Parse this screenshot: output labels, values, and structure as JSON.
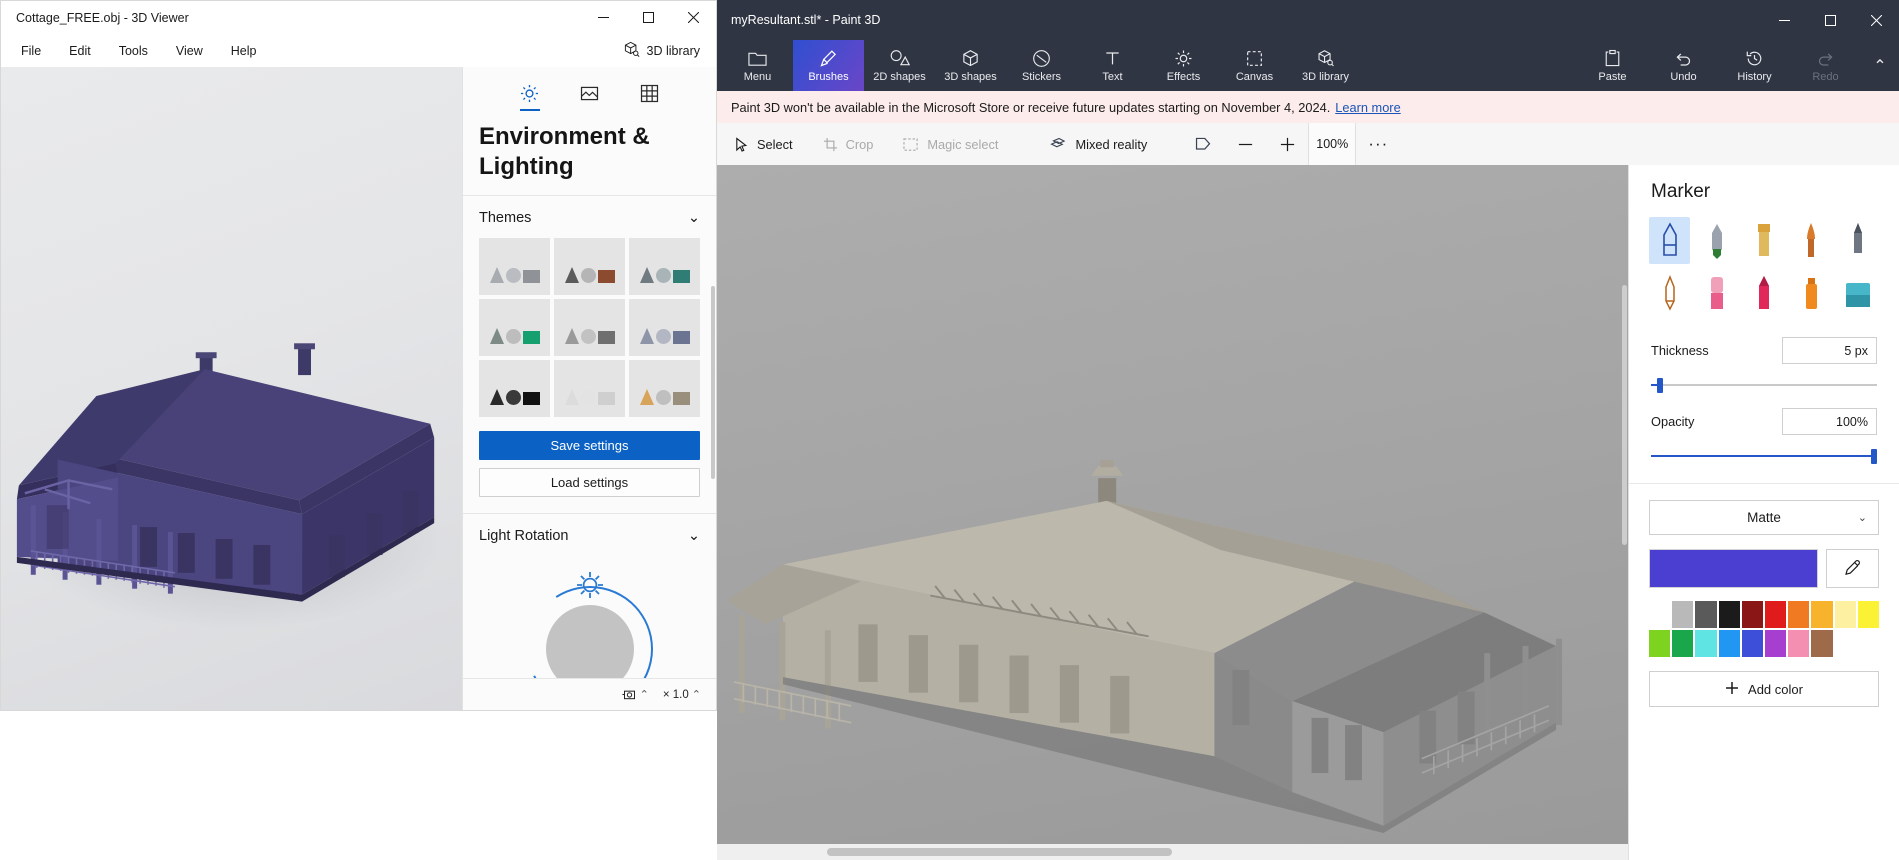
{
  "viewer": {
    "title": "Cottage_FREE.obj - 3D Viewer",
    "window_controls": {
      "minimize": "—",
      "maximize": "☐",
      "close": "✕"
    },
    "menu": [
      "File",
      "Edit",
      "Tools",
      "View",
      "Help"
    ],
    "library_label": "3D library",
    "panel": {
      "tabs": [
        "lighting-icon",
        "image-icon",
        "grid-icon"
      ],
      "heading": "Environment & Lighting",
      "themes": {
        "label": "Themes",
        "chevron": "⌄",
        "swatches": [
          {
            "sphere": "#b9bcc0",
            "box": "#8f9397",
            "cone": "#a8abaf"
          },
          {
            "sphere": "#b5b5b5",
            "box": "#8c4a2f",
            "cone": "#5b5b5b"
          },
          {
            "sphere": "#a9b4b8",
            "box": "#2f7d74",
            "cone": "#6f7b80"
          },
          {
            "sphere": "#bdbdbd",
            "box": "#16a06f",
            "cone": "#7d8a86"
          },
          {
            "sphere": "#c2c2c2",
            "box": "#6f6f6f",
            "cone": "#9a9a9a"
          },
          {
            "sphere": "#b3b7c4",
            "box": "#6b7490",
            "cone": "#8e95a8"
          },
          {
            "sphere": "#3a3a3a",
            "box": "#111111",
            "cone": "#2a2a2a"
          },
          {
            "sphere": "#e3e3e3",
            "box": "#cfcfcf",
            "cone": "#dcdcdc"
          },
          {
            "sphere": "#bfbfbf",
            "box": "#9a8f7d",
            "cone": "#d7a45a"
          }
        ],
        "save_label": "Save settings",
        "load_label": "Load settings"
      },
      "light_rotation": {
        "label": "Light Rotation",
        "chevron": "⌄"
      }
    },
    "status": {
      "zoom_label": "× 1.0",
      "chevron": "⌃"
    }
  },
  "paint3d": {
    "title": "myResultant.stl* - Paint 3D",
    "window_controls": {
      "minimize": "—",
      "maximize": "☐",
      "close": "✕"
    },
    "ribbon": [
      {
        "label": "Menu",
        "icon": "folder-icon",
        "state": "normal"
      },
      {
        "label": "Brushes",
        "icon": "brush-icon",
        "state": "active"
      },
      {
        "label": "2D shapes",
        "icon": "shapes-2d-icon",
        "state": "normal"
      },
      {
        "label": "3D shapes",
        "icon": "shapes-3d-icon",
        "state": "normal"
      },
      {
        "label": "Stickers",
        "icon": "sticker-icon",
        "state": "normal"
      },
      {
        "label": "Text",
        "icon": "text-icon",
        "state": "normal"
      },
      {
        "label": "Effects",
        "icon": "effects-icon",
        "state": "normal"
      },
      {
        "label": "Canvas",
        "icon": "canvas-icon",
        "state": "normal"
      },
      {
        "label": "3D library",
        "icon": "library-3d-icon",
        "state": "normal"
      }
    ],
    "ribbon_right": [
      {
        "label": "Paste",
        "icon": "paste-icon",
        "state": "normal"
      },
      {
        "label": "Undo",
        "icon": "undo-icon",
        "state": "normal"
      },
      {
        "label": "History",
        "icon": "history-icon",
        "state": "normal"
      },
      {
        "label": "Redo",
        "icon": "redo-icon",
        "state": "disabled"
      }
    ],
    "ribbon_collapse": "⌃",
    "banner": {
      "text": "Paint 3D won't be available in the Microsoft Store or receive future updates starting on November 4, 2024.",
      "link": "Learn more"
    },
    "toolbar": {
      "select": "Select",
      "crop": "Crop",
      "magic_select": "Magic select",
      "mixed_reality": "Mixed reality",
      "zoom_out": "—",
      "zoom_in": "+",
      "zoom_level": "100%",
      "more": "···"
    },
    "side_panel": {
      "title": "Marker",
      "brushes": [
        {
          "name": "marker-brush",
          "selected": true
        },
        {
          "name": "calligraphy-pen-brush",
          "selected": false
        },
        {
          "name": "oil-brush",
          "selected": false
        },
        {
          "name": "watercolor-brush",
          "selected": false
        },
        {
          "name": "pixel-pen-brush",
          "selected": false
        },
        {
          "name": "pencil-brush",
          "selected": false
        },
        {
          "name": "eraser-brush",
          "selected": false
        },
        {
          "name": "crayon-brush",
          "selected": false
        },
        {
          "name": "spray-can-brush",
          "selected": false
        },
        {
          "name": "fill-bucket-brush",
          "selected": false
        }
      ],
      "thickness": {
        "label": "Thickness",
        "value": "5 px",
        "percent": 4
      },
      "opacity": {
        "label": "Opacity",
        "value": "100%",
        "percent": 100
      },
      "material": {
        "value": "Matte",
        "chevron": "⌄"
      },
      "current_color": "#4a3fd0",
      "eyedropper": "eyedropper-icon",
      "palette": [
        "#ffffff",
        "#b9b9b9",
        "#5a5a5a",
        "#1b1b1b",
        "#8a1616",
        "#e01b1b",
        "#ef7a21",
        "#f7b32b",
        "#fdf0a0",
        "#fbf236",
        "#7ed321",
        "#1aa64a",
        "#5fe3e3",
        "#2196f3",
        "#3d4fd8",
        "#a63fd0",
        "#f48fb1",
        "#9e6b4a"
      ],
      "add_color": "Add color",
      "add_icon": "plus-icon"
    }
  }
}
